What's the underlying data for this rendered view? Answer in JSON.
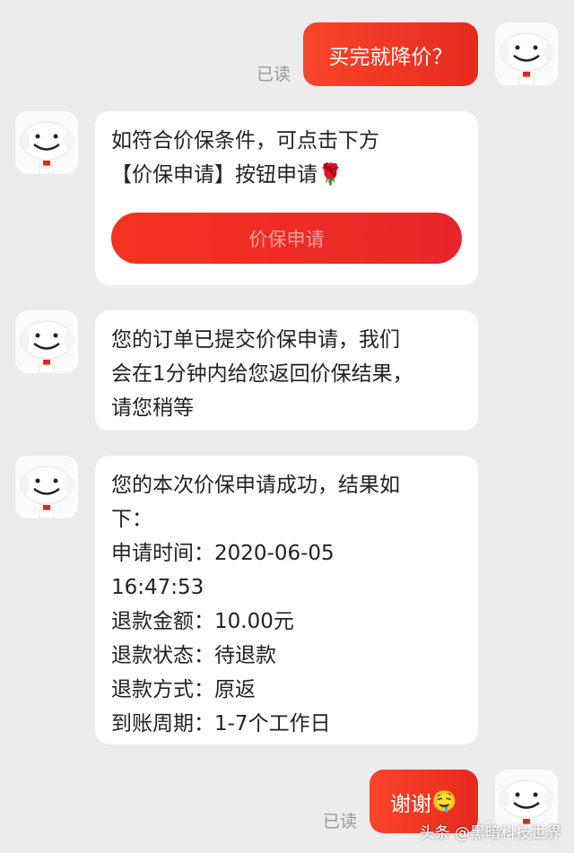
{
  "messages": {
    "m1": {
      "text": "买完就降价？",
      "status": "已读"
    },
    "m2": {
      "line1": "如符合价保条件，可点击下方",
      "line2": "【价保申请】按钮申请",
      "emoji": "🌹",
      "button": "价保申请"
    },
    "m3": {
      "line1": "您的订单已提交价保申请，我们",
      "line2": "会在1分钟内给您返回价保结果，",
      "line3": "请您稍等"
    },
    "m4": {
      "line1": "您的本次价保申请成功，结果如",
      "line2": "下：",
      "line3": "申请时间：2020-06-05",
      "line4": "16:47:53",
      "line5": "退款金额：10.00元",
      "line6": "退款状态：待退款",
      "line7": "退款方式：原返",
      "line8": "到账周期：1-7个工作日"
    },
    "m5": {
      "text": "谢谢",
      "emoji": "🤤",
      "status": "已读"
    }
  },
  "avatar_icon": "jd-dog-mascot-icon",
  "watermark": "头条 @黑暗科技世界",
  "colors": {
    "bubble_red": "#f5361f",
    "background": "#ececec",
    "bubble_white": "#ffffff"
  }
}
